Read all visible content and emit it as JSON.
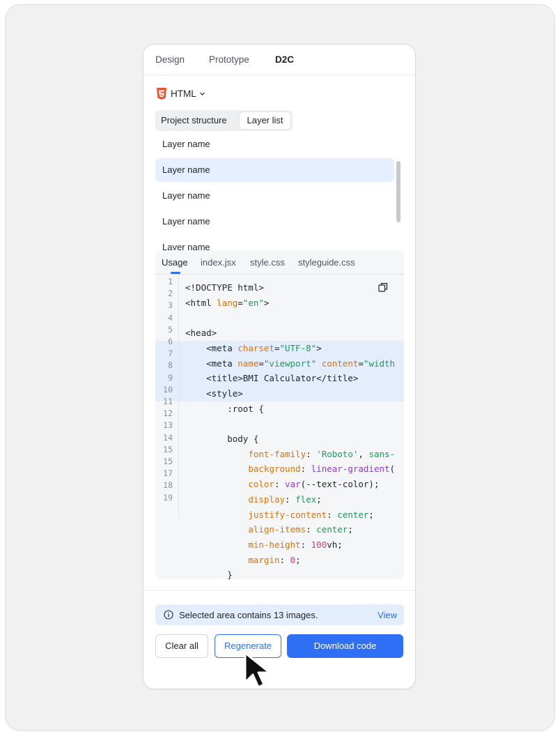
{
  "tabs": [
    {
      "label": "Design"
    },
    {
      "label": "Prototype"
    },
    {
      "label": "D2C",
      "active": true
    }
  ],
  "format": {
    "label": "HTML",
    "icon": "html5-icon",
    "chevron": "chevron-down-icon"
  },
  "segmented": {
    "items": [
      {
        "label": "Project structure"
      },
      {
        "label": "Layer list",
        "active": true
      }
    ]
  },
  "layers": [
    {
      "label": "Layer name"
    },
    {
      "label": "Layer name",
      "selected": true
    },
    {
      "label": "Layer name"
    },
    {
      "label": "Layer name"
    },
    {
      "label": "Layer name"
    }
  ],
  "code_tabs": [
    {
      "label": "Usage",
      "active": true
    },
    {
      "label": "index.jsx"
    },
    {
      "label": "style.css"
    },
    {
      "label": "styleguide.css"
    }
  ],
  "line_numbers": [
    "1",
    "2",
    "3",
    "4",
    "5",
    "6",
    "7",
    "8",
    "9",
    "10",
    "11",
    "12",
    "13",
    "14",
    "15",
    "15",
    "17",
    "18",
    "19"
  ],
  "code_lines": [
    [
      {
        "t": "<!DOCTYPE html>"
      }
    ],
    [
      {
        "t": "<html "
      },
      {
        "t": "lang",
        "c": "k"
      },
      {
        "t": "="
      },
      {
        "t": "\"en\"",
        "c": "s"
      },
      {
        "t": ">"
      }
    ],
    [
      {
        "t": ""
      }
    ],
    [
      {
        "t": "<head>"
      }
    ],
    [
      {
        "t": "    <meta "
      },
      {
        "t": "charset",
        "c": "k"
      },
      {
        "t": "="
      },
      {
        "t": "\"UTF-8\"",
        "c": "s"
      },
      {
        "t": ">"
      }
    ],
    [
      {
        "t": "    <meta "
      },
      {
        "t": "name",
        "c": "k"
      },
      {
        "t": "="
      },
      {
        "t": "\"viewport\"",
        "c": "s"
      },
      {
        "t": " "
      },
      {
        "t": "content",
        "c": "k"
      },
      {
        "t": "="
      },
      {
        "t": "\"width",
        "c": "s"
      }
    ],
    [
      {
        "t": "    <title>BMI Calculator</title>"
      }
    ],
    [
      {
        "t": "    <style>"
      }
    ],
    [
      {
        "t": "        :root {"
      }
    ],
    [
      {
        "t": ""
      }
    ],
    [
      {
        "t": "        body {"
      }
    ],
    [
      {
        "t": "            "
      },
      {
        "t": "font-family",
        "c": "k"
      },
      {
        "t": ": "
      },
      {
        "t": "'Roboto'",
        "c": "s"
      },
      {
        "t": ", "
      },
      {
        "t": "sans-",
        "c": "s"
      }
    ],
    [
      {
        "t": "            "
      },
      {
        "t": "background",
        "c": "k"
      },
      {
        "t": ": "
      },
      {
        "t": "linear-gradient",
        "c": "f"
      },
      {
        "t": "("
      }
    ],
    [
      {
        "t": "            "
      },
      {
        "t": "color",
        "c": "k"
      },
      {
        "t": ": "
      },
      {
        "t": "var",
        "c": "f"
      },
      {
        "t": "(--text-color);"
      }
    ],
    [
      {
        "t": "            "
      },
      {
        "t": "display",
        "c": "k"
      },
      {
        "t": ": "
      },
      {
        "t": "flex",
        "c": "s"
      },
      {
        "t": ";"
      }
    ],
    [
      {
        "t": "            "
      },
      {
        "t": "justify-content",
        "c": "k"
      },
      {
        "t": ": "
      },
      {
        "t": "center",
        "c": "s"
      },
      {
        "t": ";"
      }
    ],
    [
      {
        "t": "            "
      },
      {
        "t": "align-items",
        "c": "k"
      },
      {
        "t": ": "
      },
      {
        "t": "center",
        "c": "s"
      },
      {
        "t": ";"
      }
    ],
    [
      {
        "t": "            "
      },
      {
        "t": "min-height",
        "c": "k"
      },
      {
        "t": ": "
      },
      {
        "t": "100",
        "c": "n"
      },
      {
        "t": "vh;"
      }
    ],
    [
      {
        "t": "            "
      },
      {
        "t": "margin",
        "c": "k"
      },
      {
        "t": ": "
      },
      {
        "t": "0",
        "c": "n"
      },
      {
        "t": ";"
      }
    ],
    [
      {
        "t": "        }"
      }
    ]
  ],
  "info": {
    "text": "Selected area contains 13 images.",
    "link": "View",
    "icon": "info-icon"
  },
  "buttons": {
    "clear": "Clear all",
    "regenerate": "Regenerate",
    "download": "Download code"
  },
  "colors": {
    "accent": "#2f6ff5",
    "highlight": "#e3edfc",
    "keyword": "#d9730d",
    "string": "#1b9a5a",
    "function": "#8a3ad6",
    "number": "#d13b8a"
  }
}
